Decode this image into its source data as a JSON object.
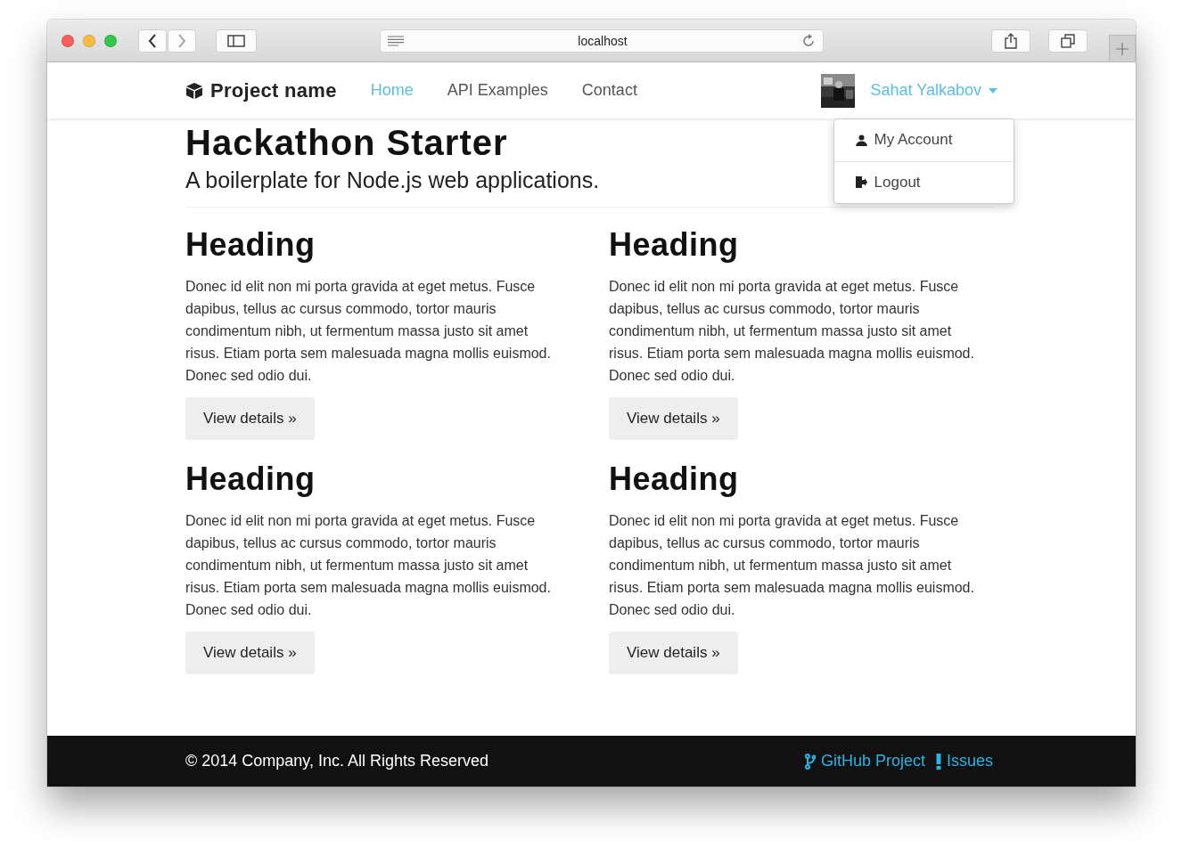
{
  "browser": {
    "url": "localhost"
  },
  "navbar": {
    "brand": "Project name",
    "links": [
      {
        "label": "Home",
        "selected": true
      },
      {
        "label": "API Examples",
        "selected": false
      },
      {
        "label": "Contact",
        "selected": false
      }
    ],
    "user": {
      "name": "Sahat Yalkabov",
      "expanded": true,
      "menu": [
        {
          "label": "My Account",
          "kind": "account"
        },
        {
          "label": "Logout",
          "kind": "logout"
        }
      ]
    }
  },
  "hero": {
    "title": "Hackathon Starter",
    "subtitle": "A boilerplate for Node.js web applications."
  },
  "cards": [
    {
      "heading": "Heading",
      "body": "Donec id elit non mi porta gravida at eget metus. Fusce dapibus, tellus ac cursus commodo, tortor mauris condimentum nibh, ut fermentum massa justo sit amet risus. Etiam porta sem malesuada magna mollis euismod. Donec sed odio dui.",
      "button": "View details »"
    },
    {
      "heading": "Heading",
      "body": "Donec id elit non mi porta gravida at eget metus. Fusce dapibus, tellus ac cursus commodo, tortor mauris condimentum nibh, ut fermentum massa justo sit amet risus. Etiam porta sem malesuada magna mollis euismod. Donec sed odio dui.",
      "button": "View details »"
    },
    {
      "heading": "Heading",
      "body": "Donec id elit non mi porta gravida at eget metus. Fusce dapibus, tellus ac cursus commodo, tortor mauris condimentum nibh, ut fermentum massa justo sit amet risus. Etiam porta sem malesuada magna mollis euismod. Donec sed odio dui.",
      "button": "View details »"
    },
    {
      "heading": "Heading",
      "body": "Donec id elit non mi porta gravida at eget metus. Fusce dapibus, tellus ac cursus commodo, tortor mauris condimentum nibh, ut fermentum massa justo sit amet risus. Etiam porta sem malesuada magna mollis euismod. Donec sed odio dui.",
      "button": "View details »"
    }
  ],
  "footer": {
    "copyright": "© 2014 Company, Inc. All Rights Reserved",
    "links": [
      {
        "label": "GitHub Project",
        "kind": "github"
      },
      {
        "label": "Issues",
        "kind": "issues"
      }
    ]
  }
}
